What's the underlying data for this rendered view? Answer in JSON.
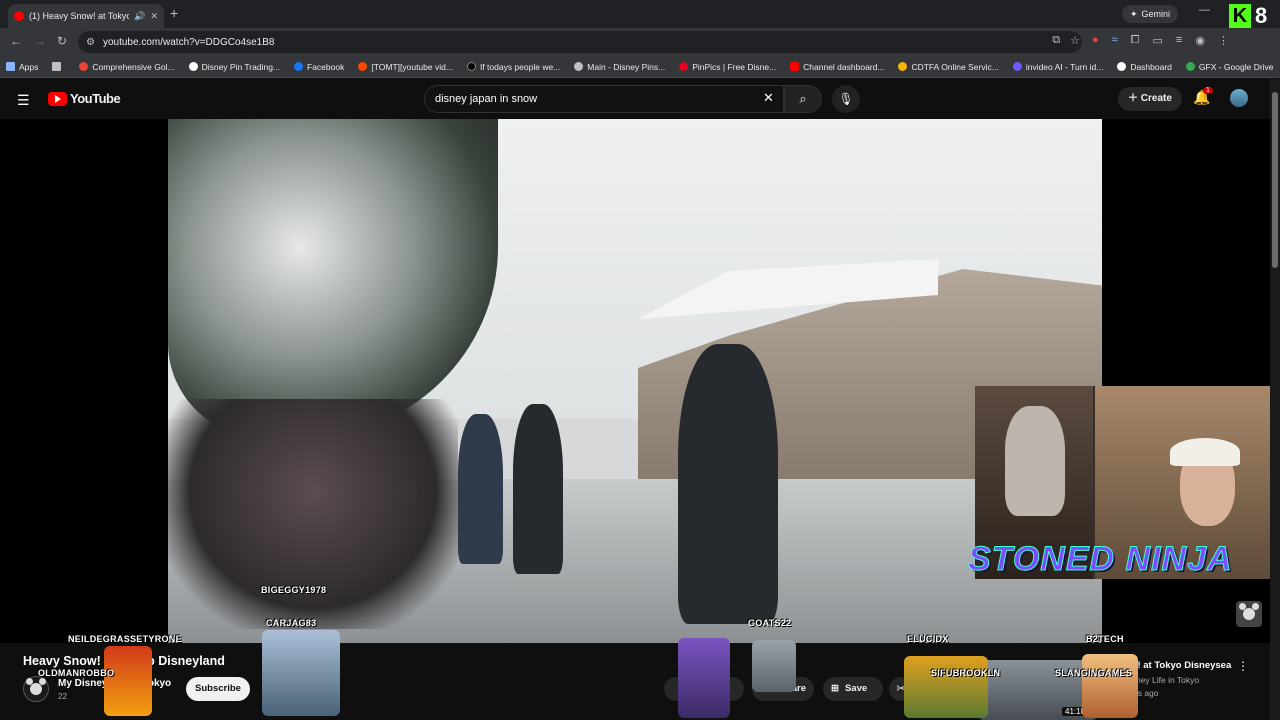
{
  "browser": {
    "tab_title": "(1) Heavy Snow! at Tokyo D",
    "url": "youtube.com/watch?v=DDGCo4se1B8",
    "gemini_label": "Gemini",
    "bookmarks": [
      {
        "label": "Apps",
        "color": "#8ab4f8"
      },
      {
        "label": "",
        "color": "#bdc1c6"
      },
      {
        "label": "Comprehensive Gol...",
        "color": "#ea4335"
      },
      {
        "label": "Disney Pin Trading...",
        "color": "#ffffff"
      },
      {
        "label": "Facebook",
        "color": "#1877f2"
      },
      {
        "label": "[TOMT][youtube vid...",
        "color": "#ff4500"
      },
      {
        "label": "If todays people we...",
        "color": "#000000"
      },
      {
        "label": "Main - Disney Pins...",
        "color": "#bdc1c6"
      },
      {
        "label": "PinPics | Free Disne...",
        "color": "#e60023"
      },
      {
        "label": "Channel dashboard...",
        "color": "#ff0000"
      },
      {
        "label": "CDTFA Online Servic...",
        "color": "#f4b400"
      },
      {
        "label": "invideo AI - Turn id...",
        "color": "#6a5cff"
      },
      {
        "label": "Dashboard",
        "color": "#ffffff"
      },
      {
        "label": "GFX - Google Drive",
        "color": "#34a853"
      }
    ]
  },
  "kick_badge": {
    "letter": "K",
    "number": "8"
  },
  "youtube": {
    "logo_text": "YouTube",
    "search_value": "disney japan in snow",
    "create_label": "Create",
    "notification_count": "1"
  },
  "overlay": {
    "brand_text": "STONED NINJA",
    "chat_names": [
      "BIGEGGY1978",
      "CARJAG83",
      "NEILDEGRASSETYRONE",
      "OLDMANROBBO",
      "GOATS22",
      "ELUCIDX",
      "B2TECH",
      "SIFUBROOKLN",
      "SLANGINGAMES"
    ]
  },
  "video": {
    "title": "Heavy Snow! at Tokyo Disneyland",
    "channel": "My Disney Life in Tokyo",
    "subscribers": "22",
    "subscribe_label": "Subscribe",
    "share_label": "Share",
    "save_label": "Save"
  },
  "recommendation": {
    "title": "Storm! at Tokyo Disneysea",
    "channel": "My Disney Life in Tokyo",
    "meta": "11 years ago",
    "duration": "41:18"
  },
  "icons": [
    "youtube-icon",
    "mute-icon",
    "close-icon",
    "back-icon",
    "forward-icon",
    "reload-icon",
    "star-icon",
    "menu-icon",
    "search-icon",
    "mic-icon",
    "bell-icon",
    "like-icon",
    "dislike-icon",
    "save-icon",
    "scissors-icon",
    "more-icon"
  ]
}
